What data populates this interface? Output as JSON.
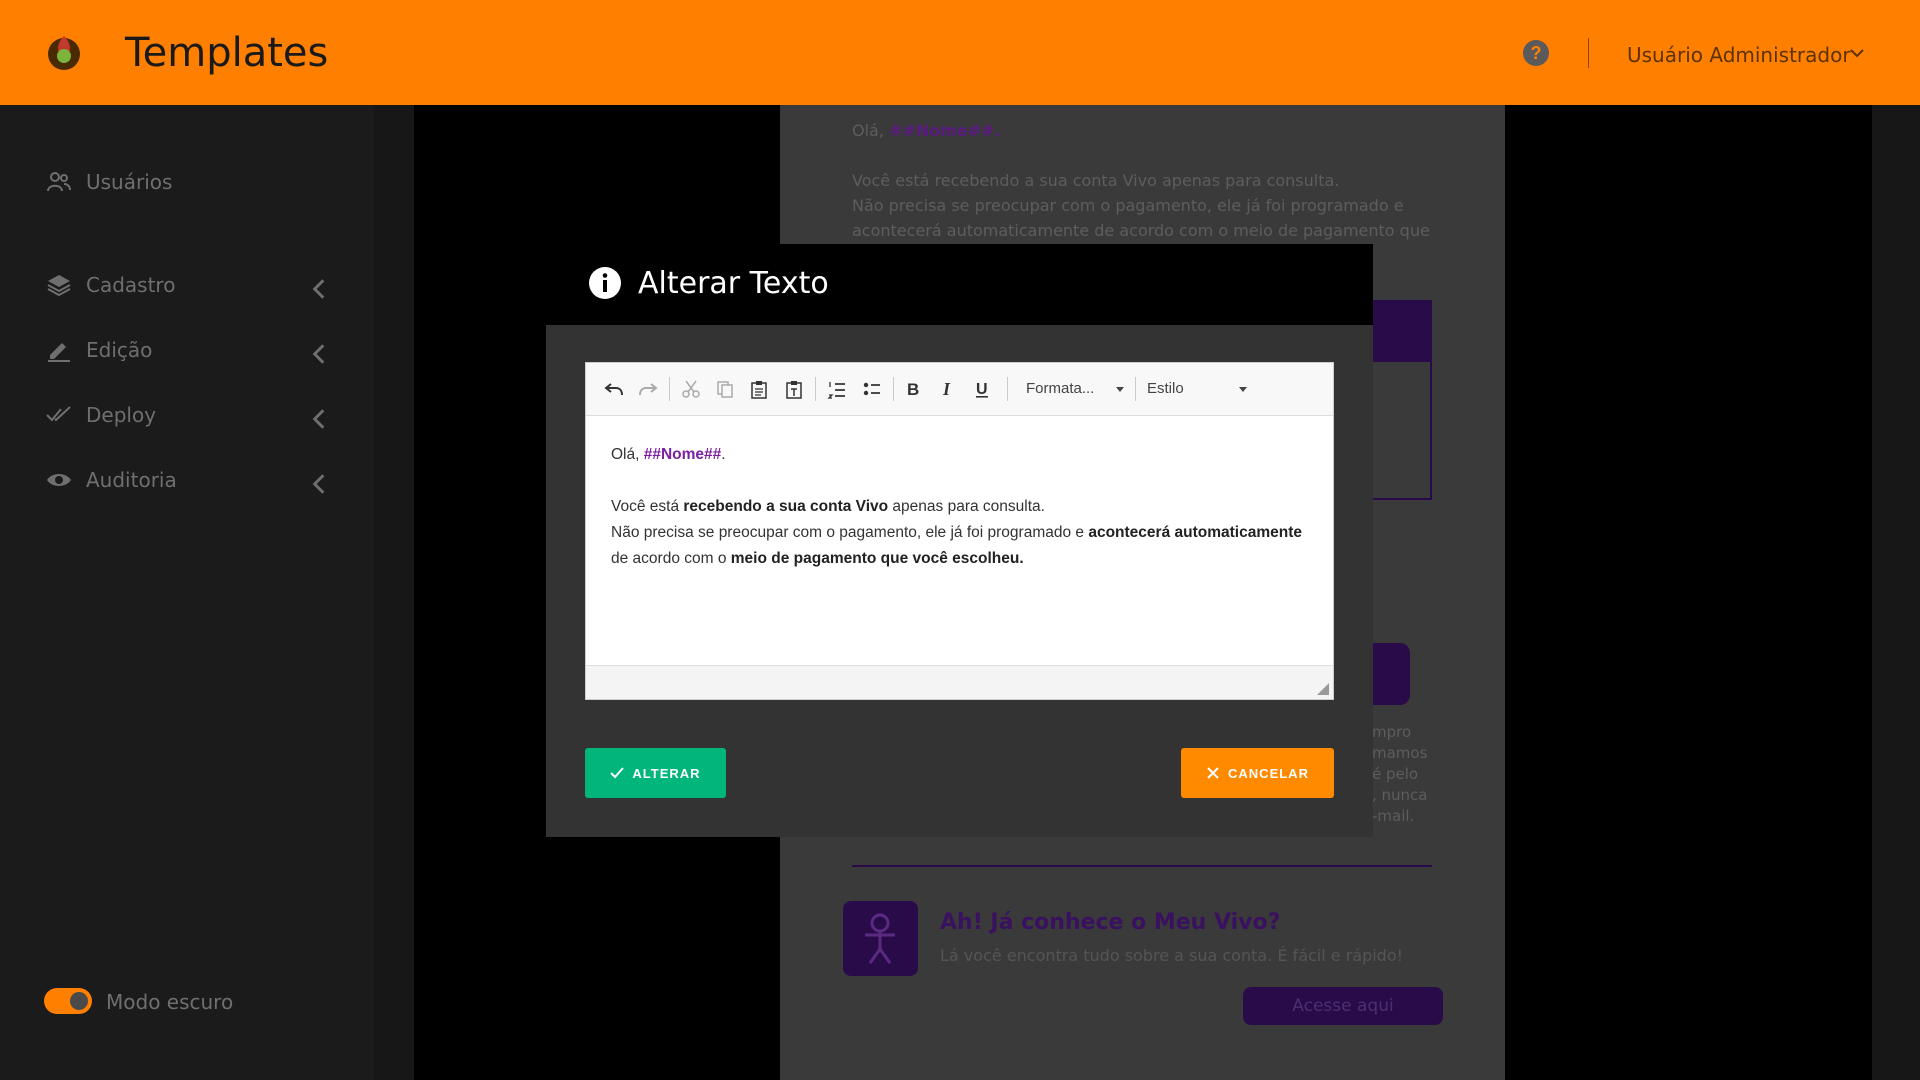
{
  "header": {
    "title": "Templates",
    "user_name": "Usuário Administrador",
    "help_symbol": "?"
  },
  "sidebar": {
    "items": [
      {
        "label": "Usuários",
        "icon": "users-icon"
      },
      {
        "label": "Cadastro",
        "icon": "layers-icon"
      },
      {
        "label": "Edição",
        "icon": "pen-icon"
      },
      {
        "label": "Deploy",
        "icon": "double-check-icon"
      },
      {
        "label": "Auditoria",
        "icon": "eye-icon"
      }
    ],
    "dark_mode_label": "Modo escuro"
  },
  "preview": {
    "greeting_prefix": "Olá, ",
    "greeting_var": "##Nome##.",
    "line1": "Você está recebendo a sua conta Vivo apenas para consulta.",
    "line2": "Não precisa se preocupar com o pagamento, ele já foi programado e",
    "line3": "acontecerá automaticamente de acordo com o meio de pagamento que",
    "right_line1": "mpro",
    "right_line2": "mamos",
    "right_line3": "é pelo",
    "right_line4": ", nunca",
    "right_line5": "-mail.",
    "meu_vivo_title": "Ah! Já conhece o Meu Vivo?",
    "meu_vivo_sub": "Lá você encontra tudo sobre a sua conta. É fácil e rápido!",
    "acesso_button": "Acesse aqui"
  },
  "modal": {
    "title": "Alterar Texto",
    "toolbar": {
      "format_dropdown": "Formata...",
      "style_dropdown": "Estilo"
    },
    "content": {
      "greeting_prefix": "Olá, ",
      "greeting_var": "##Nome##",
      "greeting_suffix": ".",
      "p1_a": "Você está ",
      "p1_b": "recebendo a sua conta Vivo",
      "p1_c": " apenas para consulta.",
      "p2_a": "Não precisa se preocupar com o pagamento, ele já foi programado e ",
      "p2_b": "acontecerá automaticamente",
      "p2_c": " de acordo com o ",
      "p2_d": "meio de pagamento que você escolheu."
    },
    "confirm_button": "ALTERAR",
    "cancel_button": "CANCELAR"
  },
  "colors": {
    "header_bg": "#ff7f00",
    "confirm": "#00b67a",
    "cancel": "#ff8a00",
    "variable": "#7a1fa0"
  }
}
